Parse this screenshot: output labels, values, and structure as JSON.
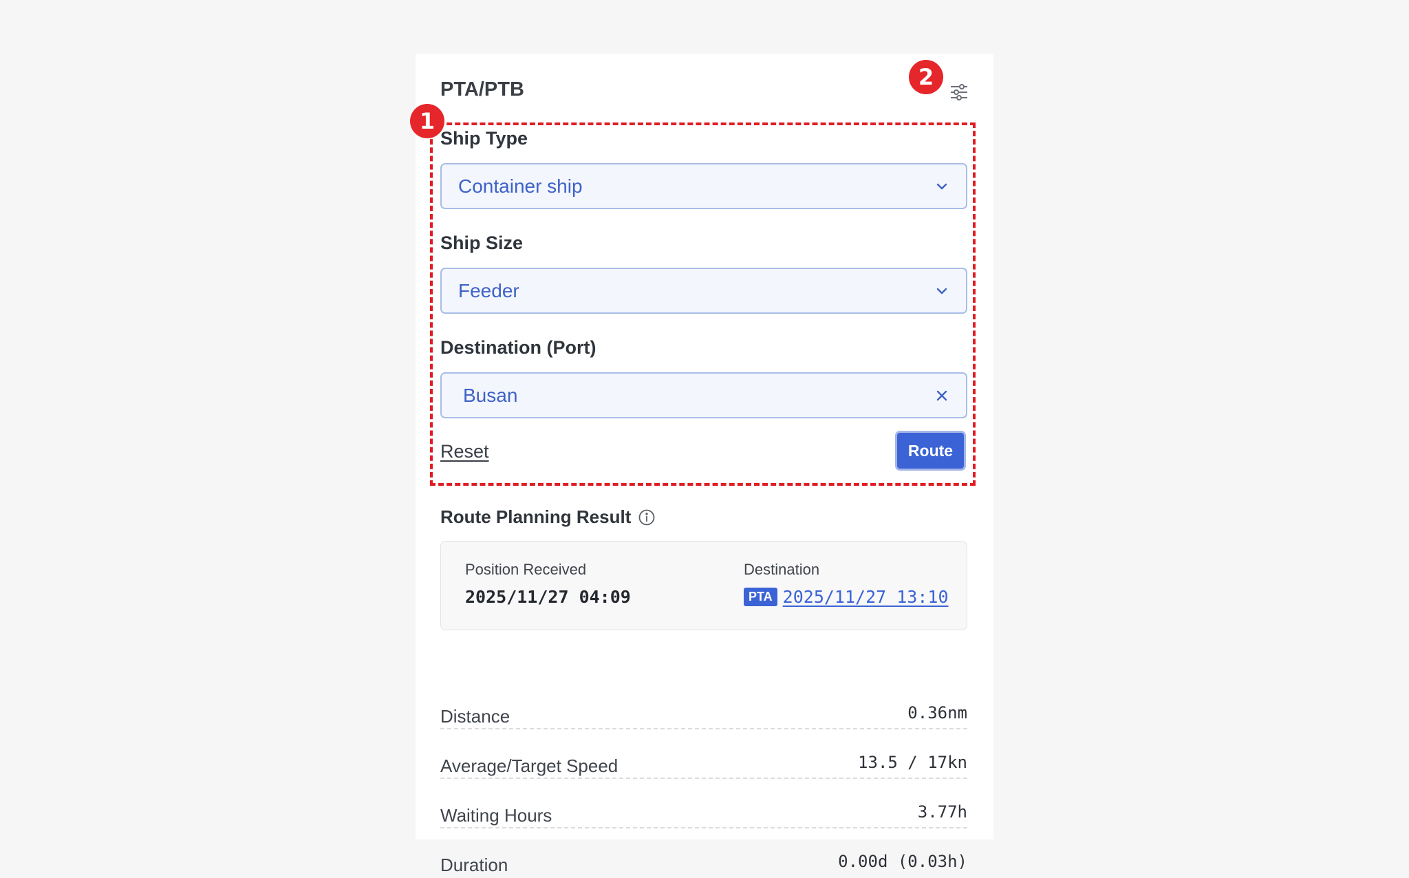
{
  "panel": {
    "title": "PTA/PTB",
    "settings_icon": "sliders-icon"
  },
  "badges": {
    "one": "1",
    "two": "2"
  },
  "form": {
    "ship_type": {
      "label": "Ship Type",
      "value": "Container ship"
    },
    "ship_size": {
      "label": "Ship Size",
      "value": "Feeder"
    },
    "destination": {
      "label": "Destination (Port)",
      "value": "Busan"
    },
    "reset_label": "Reset",
    "route_label": "Route"
  },
  "result": {
    "title": "Route Planning Result",
    "position_received": {
      "label": "Position Received",
      "value": "2025/11/27 04:09"
    },
    "destination": {
      "label": "Destination",
      "tag": "PTA",
      "value": "2025/11/27 13:10"
    },
    "stats": [
      {
        "label": "Distance",
        "value": "0.36nm"
      },
      {
        "label": "Average/Target Speed",
        "value": "13.5 / 17kn"
      },
      {
        "label": "Waiting Hours",
        "value": "3.77h"
      },
      {
        "label": "Duration",
        "value": "0.00d (0.03h)"
      }
    ]
  },
  "colors": {
    "accent": "#3b63d6",
    "highlight": "#e01d24",
    "select_bg": "#f3f6fc"
  }
}
